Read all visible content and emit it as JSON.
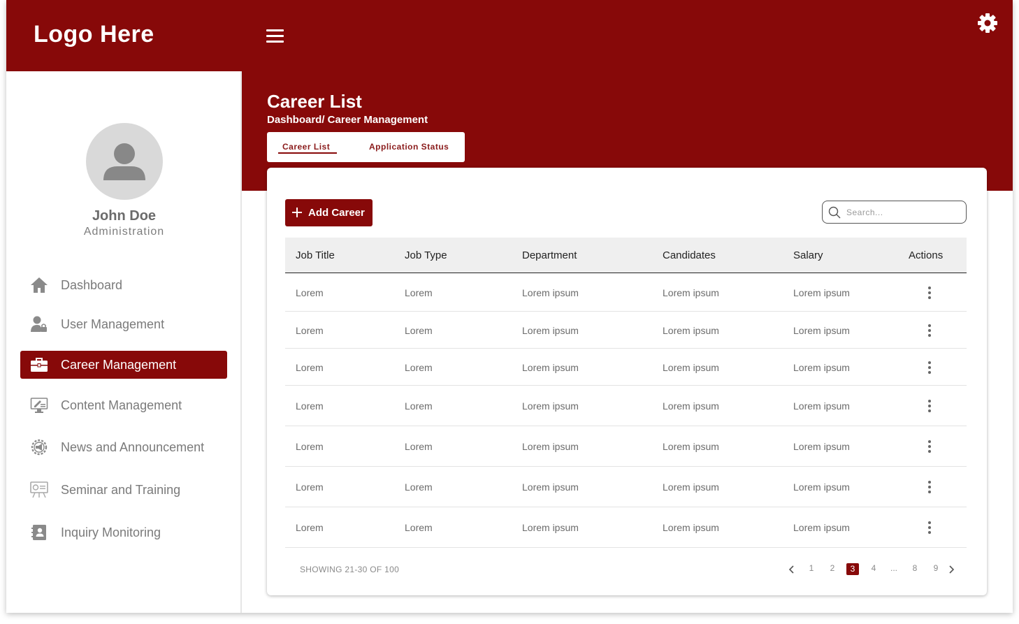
{
  "header": {
    "logo_text": "Logo Here",
    "menu_icon": "hamburger-icon",
    "settings_icon": "gear-icon",
    "brand_color": "#870909"
  },
  "user": {
    "name": "John Doe",
    "role": "Administration",
    "avatar_icon": "user-icon"
  },
  "sidebar": {
    "items": [
      {
        "label": "Dashboard",
        "icon": "home-icon",
        "active": false
      },
      {
        "label": "User Management",
        "icon": "user-lock-icon",
        "active": false
      },
      {
        "label": "Career Management",
        "icon": "briefcase-icon",
        "active": true
      },
      {
        "label": "Content Management",
        "icon": "monitor-edit-icon",
        "active": false
      },
      {
        "label": "News and Announcement",
        "icon": "gear-megaphone-icon",
        "active": false
      },
      {
        "label": "Seminar and Training",
        "icon": "presentation-board-icon",
        "active": false
      },
      {
        "label": "Inquiry Monitoring",
        "icon": "contact-book-icon",
        "active": false
      }
    ]
  },
  "page": {
    "title": "Career List",
    "breadcrumb": "Dashboard/ Career Management"
  },
  "tabs": [
    {
      "label": "Career List",
      "active": true
    },
    {
      "label": "Application Status",
      "active": false
    }
  ],
  "toolbar": {
    "add_label": "Add Career",
    "search_placeholder": "Search..."
  },
  "table": {
    "columns": [
      "Job Title",
      "Job Type",
      "Department",
      "Candidates",
      "Salary",
      "Actions"
    ],
    "rows": [
      [
        "Lorem",
        "Lorem",
        "Lorem ipsum",
        "Lorem ipsum",
        "Lorem ipsum"
      ],
      [
        "Lorem",
        "Lorem",
        "Lorem ipsum",
        "Lorem ipsum",
        "Lorem ipsum"
      ],
      [
        "Lorem",
        "Lorem",
        "Lorem ipsum",
        "Lorem ipsum",
        "Lorem ipsum"
      ],
      [
        "Lorem",
        "Lorem",
        "Lorem ipsum",
        "Lorem ipsum",
        "Lorem ipsum"
      ],
      [
        "Lorem",
        "Lorem",
        "Lorem ipsum",
        "Lorem ipsum",
        "Lorem ipsum"
      ],
      [
        "Lorem",
        "Lorem",
        "Lorem ipsum",
        "Lorem ipsum",
        "Lorem ipsum"
      ],
      [
        "Lorem",
        "Lorem",
        "Lorem ipsum",
        "Lorem ipsum",
        "Lorem ipsum"
      ]
    ],
    "row_action_icon": "more-vertical-icon"
  },
  "pagination": {
    "showing": "SHOWING 21-30 OF 100",
    "prev_icon": "chevron-left-icon",
    "next_icon": "chevron-right-icon",
    "pages": [
      "1",
      "2",
      "3",
      "4",
      "...",
      "8",
      "9"
    ],
    "current": "3"
  }
}
